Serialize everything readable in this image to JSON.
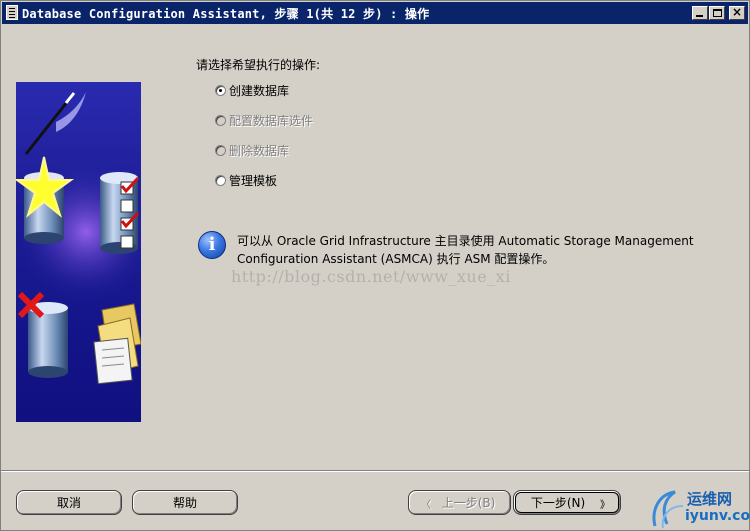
{
  "window": {
    "title": "Database Configuration Assistant, 步骤 1(共 12 步) : 操作"
  },
  "main": {
    "prompt": "请选择希望执行的操作:",
    "options": [
      {
        "label": "创建数据库",
        "selected": true,
        "enabled": true
      },
      {
        "label": "配置数据库选件",
        "selected": false,
        "enabled": false
      },
      {
        "label": "删除数据库",
        "selected": false,
        "enabled": false
      },
      {
        "label": "管理模板",
        "selected": false,
        "enabled": true
      }
    ],
    "info": "可以从 Oracle Grid Infrastructure 主目录使用 Automatic Storage Management Configuration Assistant (ASMCA) 执行 ASM 配置操作。",
    "watermark": "http://blog.csdn.net/www_xue_xi"
  },
  "buttons": {
    "cancel": "取消",
    "help": "帮助",
    "back": "上一步(B)",
    "next": "下一步(N)"
  },
  "logo": {
    "cn": "运维网",
    "en": "iyunv.com"
  },
  "colors": {
    "titlebar": "#0a246a",
    "dialog": "#d4d0c8",
    "illustration": "#1c1c94"
  }
}
